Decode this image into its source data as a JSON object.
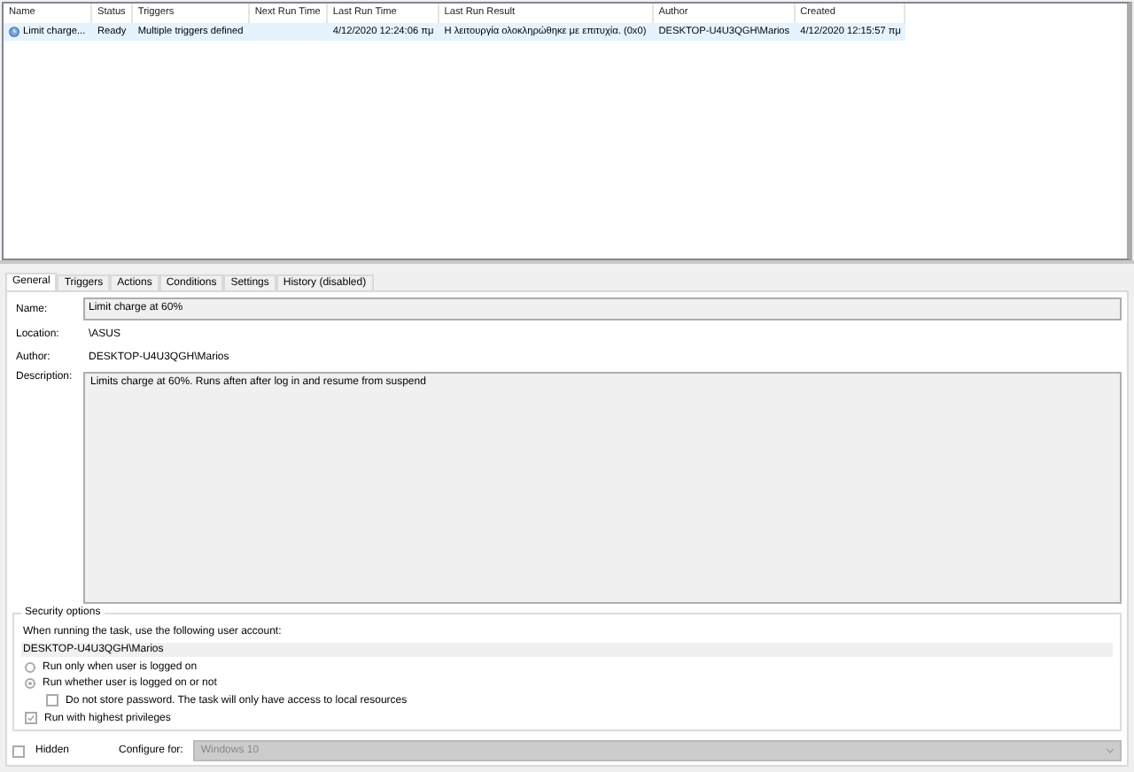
{
  "task_list": {
    "columns": [
      "Name",
      "Status",
      "Triggers",
      "Next Run Time",
      "Last Run Time",
      "Last Run Result",
      "Author",
      "Created"
    ],
    "rows": [
      {
        "selected": true,
        "cells": [
          "Limit charge...",
          "Ready",
          "Multiple triggers defined",
          "",
          "4/12/2020 12:24:06 πμ",
          "Η λειτουργία ολοκληρώθηκε με επιτυχία. (0x0)",
          "DESKTOP-U4U3QGH\\Marios",
          "4/12/2020 12:15:57 πμ"
        ]
      }
    ]
  },
  "tabs": [
    {
      "label": "General",
      "selected": true
    },
    {
      "label": "Triggers",
      "selected": false
    },
    {
      "label": "Actions",
      "selected": false
    },
    {
      "label": "Conditions",
      "selected": false
    },
    {
      "label": "Settings",
      "selected": false
    },
    {
      "label": "History (disabled)",
      "selected": false
    }
  ],
  "general": {
    "name_label": "Name:",
    "name_value": "Limit charge at 60%",
    "location_label": "Location:",
    "location_value": "\\ASUS",
    "author_label": "Author:",
    "author_value": "DESKTOP-U4U3QGH\\Marios",
    "description_label": "Description:",
    "description_value": "Limits charge at 60%. Runs aften after log in and resume from suspend"
  },
  "security": {
    "title": "Security options",
    "account_prompt": "When running the task, use the following user account:",
    "account": "DESKTOP-U4U3QGH\\Marios",
    "options": [
      {
        "kind": "radio",
        "label": "Run only when user is logged on",
        "checked": false
      },
      {
        "kind": "radio",
        "label": "Run whether user is logged on or not",
        "checked": true
      },
      {
        "kind": "checkbox",
        "label": "Do not store password.  The task will only have access to local resources",
        "checked": false,
        "indented": true
      },
      {
        "kind": "checkbox",
        "label": "Run with highest privileges",
        "checked": true
      }
    ]
  },
  "footer": {
    "hidden_label": "Hidden",
    "hidden_checked": false,
    "configure_label": "Configure for:",
    "configure_value": "Windows 10"
  }
}
